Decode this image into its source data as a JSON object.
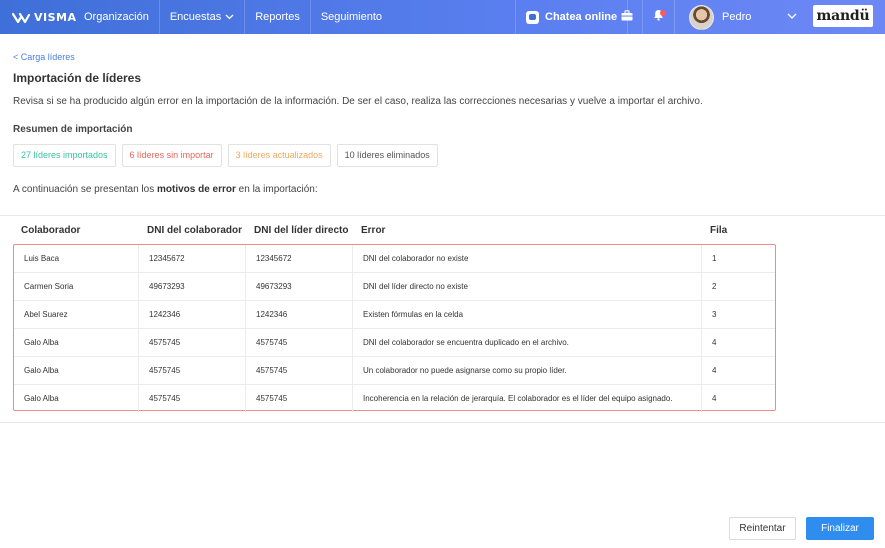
{
  "colors": {
    "topbar": "#4a78e6",
    "link": "#4a7fe0",
    "imported": "#3bbfa6",
    "not_imported": "#e5655c",
    "updated": "#f0a860",
    "deleted": "#555555",
    "error_border": "#f08a8a",
    "primary_button": "#2f8df0"
  },
  "topbar": {
    "logo_text": "VISMA",
    "nav": [
      {
        "label": "Organización"
      },
      {
        "label": "Encuestas",
        "icon": "chevron-down-icon"
      },
      {
        "label": "Reportes"
      },
      {
        "label": "Seguimiento"
      }
    ],
    "chat_label": "Chatea online",
    "user_name": "Pedro",
    "brand": "mandü"
  },
  "breadcrumb": {
    "back_label": "< Carga líderes"
  },
  "page": {
    "title": "Importación de líderes",
    "description": "Revisa si se ha producido algún error en la importación de la información. De ser el caso, realiza las correcciones necesarias y vuelve a importar el archivo.",
    "summary_title": "Resumen de importación",
    "summary": {
      "imported": "27 líderes importados",
      "not_imported": "6 líderes sin importar",
      "updated": "3 líderes actualizados",
      "deleted": "10 líderes eliminados"
    },
    "intro_before": "A continuación se presentan los ",
    "intro_bold": "motivos de error",
    "intro_after": " en la importación:"
  },
  "table": {
    "headers": {
      "colaborador": "Colaborador",
      "dni": "DNI del colaborador",
      "dni_lider": "DNI del líder directo",
      "error": "Error",
      "fila": "Fila"
    },
    "rows": [
      {
        "colaborador": "Luis Baca",
        "dni": "12345672",
        "dni_lider": "12345672",
        "error": "DNI del colaborador no existe",
        "fila": "1"
      },
      {
        "colaborador": "Carmen Soria",
        "dni": "49673293",
        "dni_lider": "49673293",
        "error": "DNI del líder directo no existe",
        "fila": "2"
      },
      {
        "colaborador": "Abel Suarez",
        "dni": "1242346",
        "dni_lider": "1242346",
        "error": "Existen fórmulas en la celda",
        "fila": "3"
      },
      {
        "colaborador": "Galo Alba",
        "dni": "4575745",
        "dni_lider": "4575745",
        "error": "DNI del colaborador se encuentra duplicado en el archivo.",
        "fila": "4"
      },
      {
        "colaborador": "Galo Alba",
        "dni": "4575745",
        "dni_lider": "4575745",
        "error": "Un colaborador no puede asignarse como su propio líder.",
        "fila": "4"
      },
      {
        "colaborador": "Galo Alba",
        "dni": "4575745",
        "dni_lider": "4575745",
        "error": "Incoherencia en la relación de jerarquía. El colaborador es el líder del equipo asignado.",
        "fila": "4"
      }
    ]
  },
  "actions": {
    "retry": "Reintentar",
    "finish": "Finalizar"
  }
}
